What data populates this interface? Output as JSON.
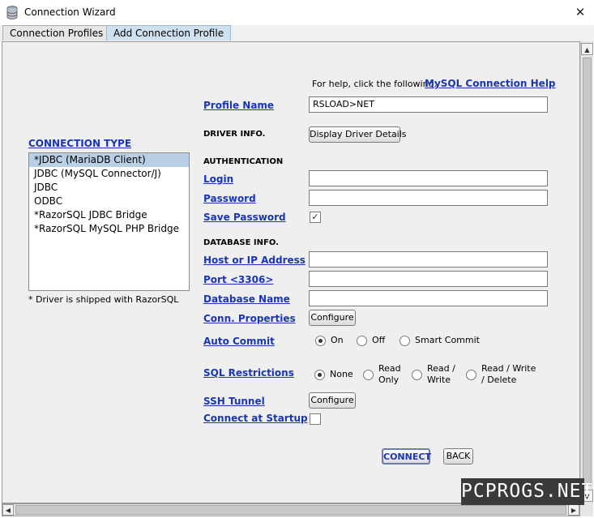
{
  "window": {
    "title": "Connection Wizard",
    "close_glyph": "✕"
  },
  "tabs": [
    "Connection Profiles",
    "Add Connection Profile"
  ],
  "help": {
    "prompt": "For help, click the following:",
    "link": "MySQL Connection Help"
  },
  "connection_type": {
    "heading": "CONNECTION TYPE",
    "items": [
      "*JDBC (MariaDB Client)",
      "JDBC (MySQL Connector/J)",
      "JDBC",
      "ODBC",
      "*RazorSQL JDBC Bridge",
      "*RazorSQL MySQL PHP Bridge"
    ],
    "selected": "*JDBC (MariaDB Client)",
    "note": "* Driver is shipped with RazorSQL"
  },
  "form": {
    "profile_name_label": "Profile Name",
    "profile_name_value": "RSLOAD>NET",
    "driver_info_label": "DRIVER INFO.",
    "driver_details_button": "Display Driver Details",
    "authentication_label": "AUTHENTICATION",
    "login_label": "Login",
    "login_value": "",
    "password_label": "Password",
    "password_value": "",
    "save_password_label": "Save Password",
    "save_password_checked": true,
    "check_glyph": "✓",
    "database_info_label": "DATABASE INFO.",
    "host_label": "Host or IP Address",
    "host_value": "",
    "port_label": "Port <3306>",
    "port_value": "",
    "database_name_label": "Database Name",
    "database_name_value": "",
    "conn_properties_label": "Conn. Properties",
    "configure_label": "Configure",
    "auto_commit_label": "Auto Commit",
    "auto_commit_options": [
      "On",
      "Off",
      "Smart Commit"
    ],
    "auto_commit_selected": "On",
    "sql_restrictions_label": "SQL Restrictions",
    "sql_restriction_options": [
      "None",
      "Read\nOnly",
      "Read /\nWrite",
      "Read / Write\n/ Delete"
    ],
    "sql_restriction_selected": "None",
    "ssh_tunnel_label": "SSH Tunnel",
    "ssh_configure_label": "Configure",
    "connect_at_startup_label": "Connect at Startup",
    "connect_at_startup_checked": false
  },
  "actions": {
    "connect": "CONNECT",
    "back": "BACK"
  },
  "watermark": "PCPROGS.NET",
  "scroll_glyphs": {
    "up": "▲",
    "down": "▼",
    "left": "◀",
    "right": "▶"
  },
  "colors": {
    "link": "#1a36b4",
    "selected_row": "#b8cfe5",
    "panel": "#efefef"
  }
}
